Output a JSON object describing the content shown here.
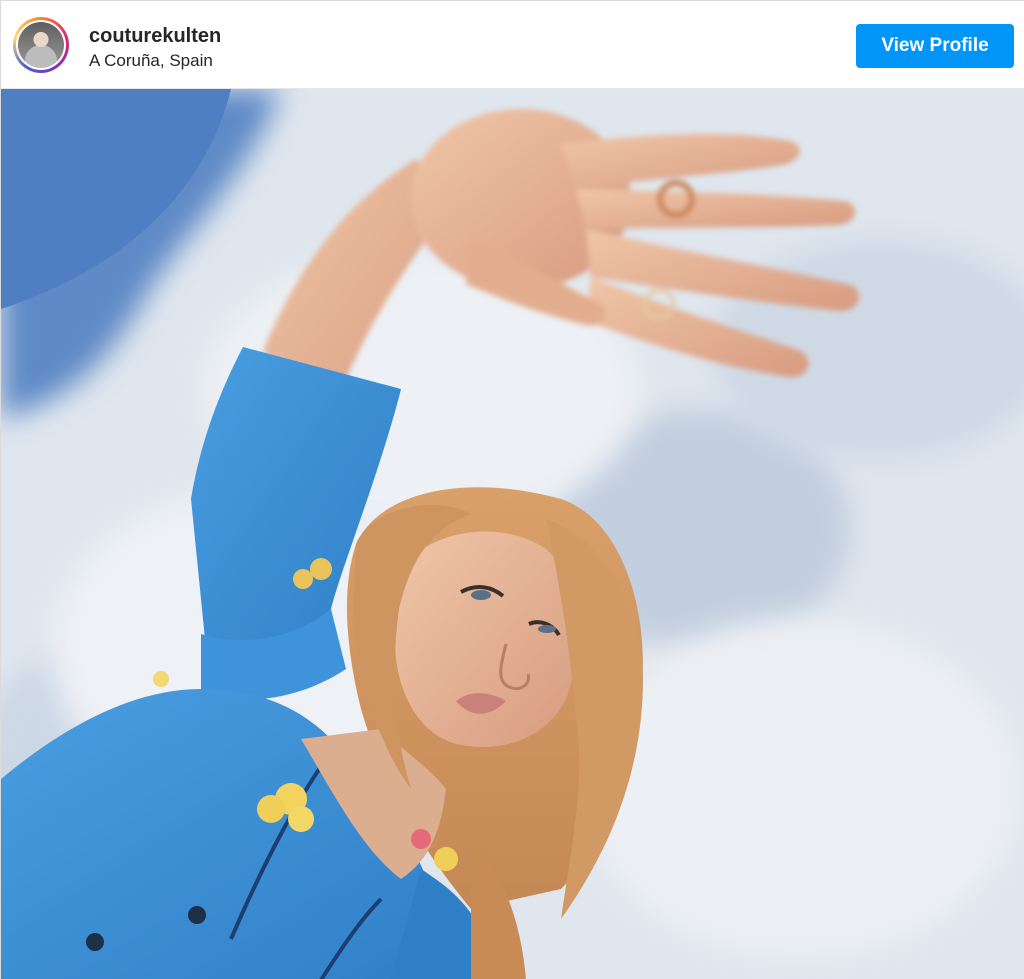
{
  "post": {
    "username": "couturekulten",
    "location": "A Coruña, Spain",
    "view_profile_label": "View Profile"
  },
  "photo": {
    "subject": "woman in blue floral shirt reaching toward camera against cloudy sky"
  },
  "colors": {
    "button": "#0095f6",
    "sky_blue": "#5b86c4",
    "shirt_blue": "#3a8fd6"
  },
  "icons": {
    "avatar": "profile-avatar-icon"
  }
}
